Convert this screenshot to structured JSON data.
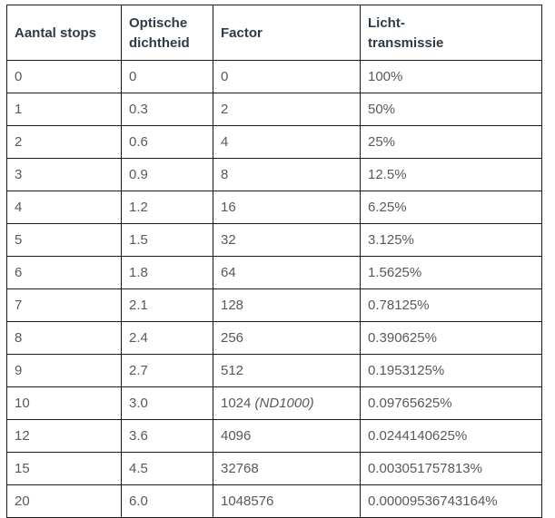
{
  "table": {
    "caption": "Aantal stops / Optische dichtheid / Factor / Lichttransmissie",
    "headers": [
      {
        "id": "stops",
        "lines": [
          "Aantal stops"
        ]
      },
      {
        "id": "density",
        "lines": [
          "Optische",
          "dichtheid"
        ]
      },
      {
        "id": "factor",
        "lines": [
          "Factor"
        ]
      },
      {
        "id": "trans",
        "lines": [
          "Licht-",
          "transmissie"
        ]
      }
    ],
    "rows": [
      {
        "stops": "0",
        "density": "0",
        "factor": "0",
        "factor_note": "",
        "trans": "100%"
      },
      {
        "stops": "1",
        "density": "0.3",
        "factor": "2",
        "factor_note": "",
        "trans": "50%"
      },
      {
        "stops": "2",
        "density": "0.6",
        "factor": "4",
        "factor_note": "",
        "trans": "25%"
      },
      {
        "stops": "3",
        "density": "0.9",
        "factor": "8",
        "factor_note": "",
        "trans": "12.5%"
      },
      {
        "stops": "4",
        "density": "1.2",
        "factor": "16",
        "factor_note": "",
        "trans": "6.25%"
      },
      {
        "stops": "5",
        "density": "1.5",
        "factor": "32",
        "factor_note": "",
        "trans": "3.125%"
      },
      {
        "stops": "6",
        "density": "1.8",
        "factor": "64",
        "factor_note": "",
        "trans": "1.5625%"
      },
      {
        "stops": "7",
        "density": "2.1",
        "factor": "128",
        "factor_note": "",
        "trans": "0.78125%"
      },
      {
        "stops": "8",
        "density": "2.4",
        "factor": "256",
        "factor_note": "",
        "trans": "0.390625%"
      },
      {
        "stops": "9",
        "density": "2.7",
        "factor": "512",
        "factor_note": "",
        "trans": "0.1953125%"
      },
      {
        "stops": "10",
        "density": "3.0",
        "factor": "1024",
        "factor_note": "(ND1000)",
        "trans": "0.09765625%"
      },
      {
        "stops": "12",
        "density": "3.6",
        "factor": "4096",
        "factor_note": "",
        "trans": "0.0244140625%"
      },
      {
        "stops": "15",
        "density": "4.5",
        "factor": "32768",
        "factor_note": "",
        "trans": "0.003051757813%"
      },
      {
        "stops": "20",
        "density": "6.0",
        "factor": "1048576",
        "factor_note": "",
        "trans": "0.00009536743164%"
      }
    ]
  },
  "colors": {
    "border": "#1a1a1a",
    "header_text": "#2f3b46",
    "body_text": "#59595b",
    "background": "#ffffff"
  }
}
